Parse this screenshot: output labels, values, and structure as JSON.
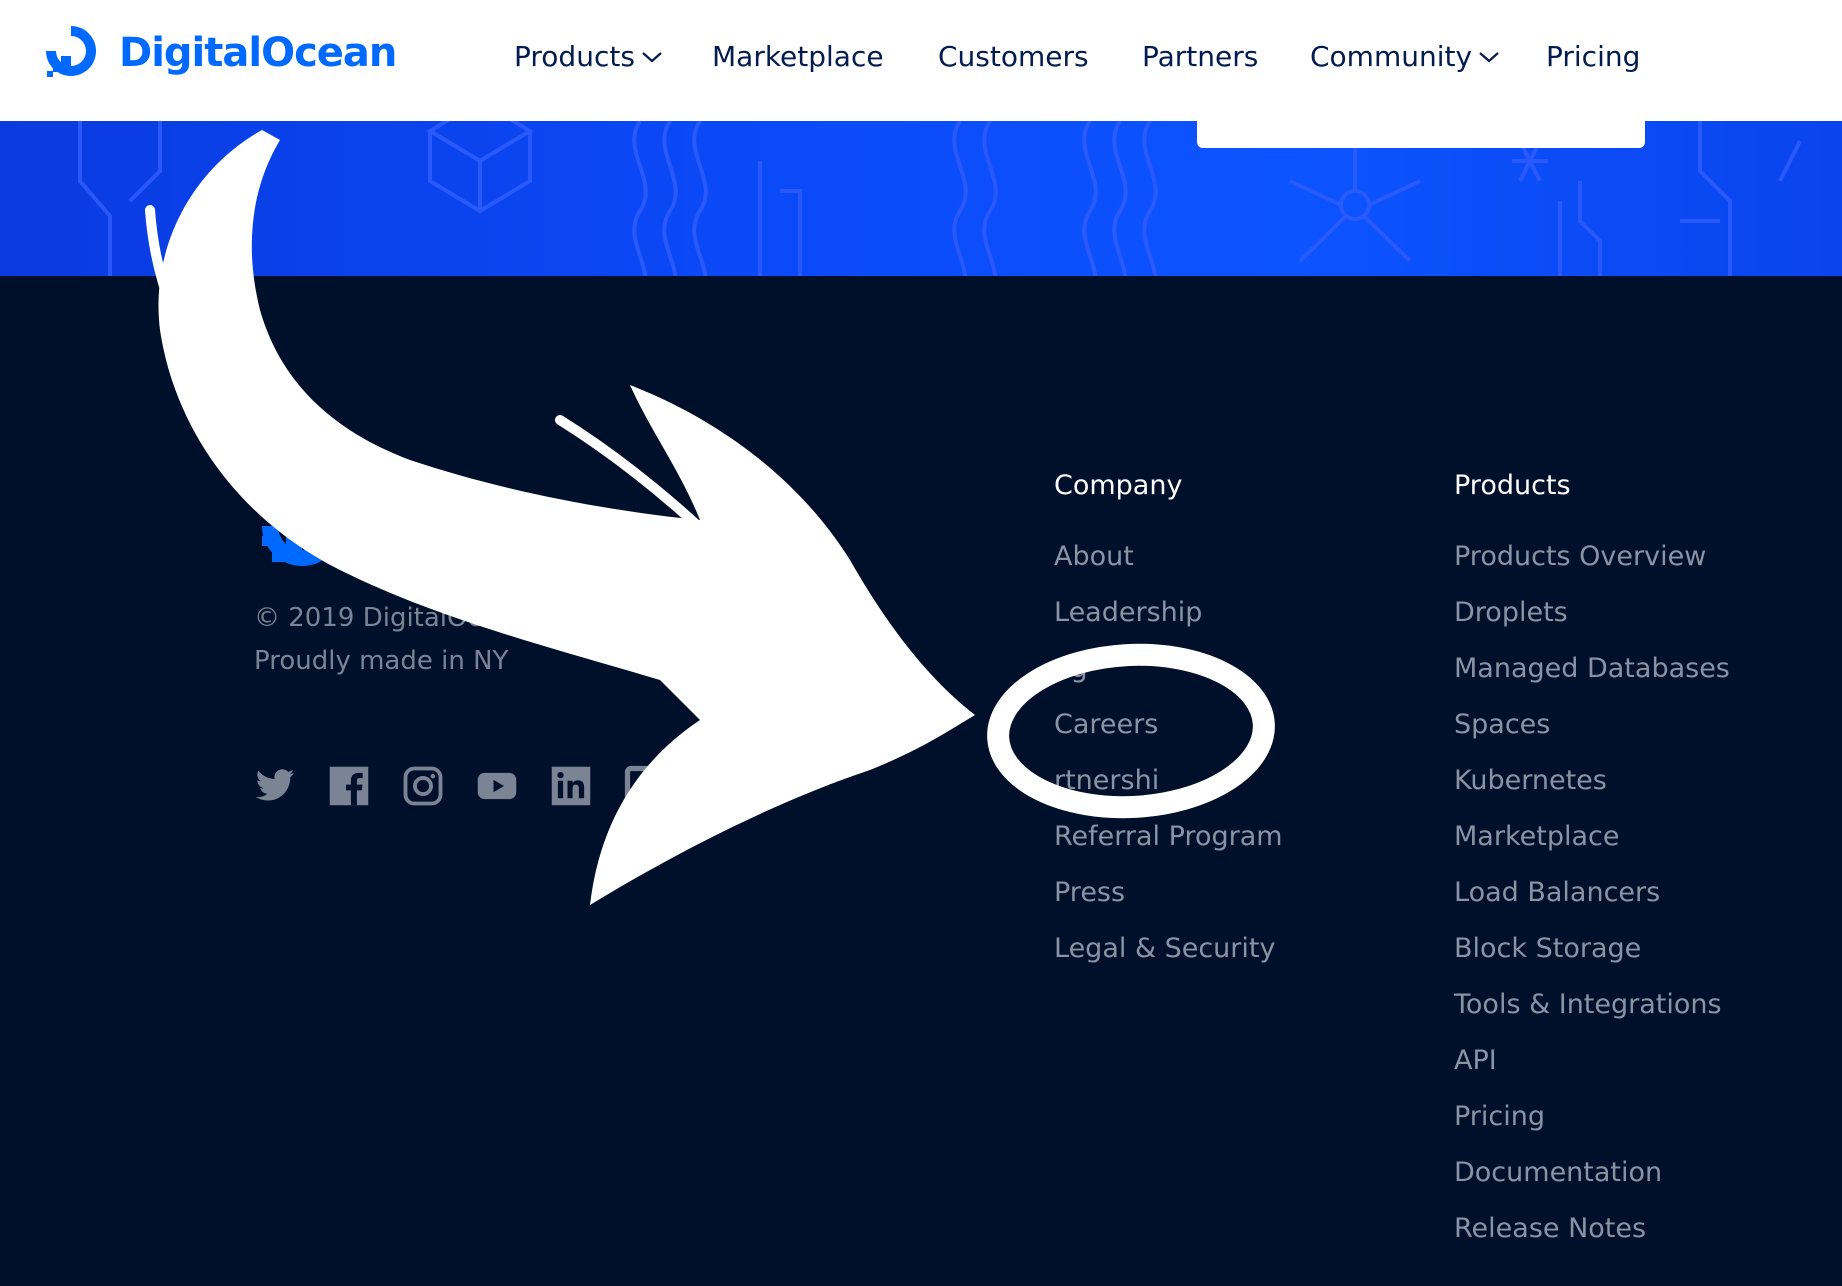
{
  "brand": {
    "name": "DigitalOcean",
    "color": "#0069ff",
    "logo_icon": "digitalocean-logo-icon"
  },
  "nav": {
    "items": [
      {
        "label": "Products",
        "has_dropdown": true
      },
      {
        "label": "Marketplace",
        "has_dropdown": false
      },
      {
        "label": "Customers",
        "has_dropdown": false
      },
      {
        "label": "Partners",
        "has_dropdown": false
      },
      {
        "label": "Community",
        "has_dropdown": true
      },
      {
        "label": "Pricing",
        "has_dropdown": false
      }
    ]
  },
  "footer": {
    "copyright": "© 2019 DigitalOc",
    "tagline": "Proudly made in NY",
    "social_icons": [
      "twitter-icon",
      "facebook-icon",
      "instagram-icon",
      "youtube-icon",
      "linkedin-icon",
      "partial-icon"
    ],
    "company": {
      "heading": "Company",
      "links": [
        "About",
        "Leadership",
        "og",
        "Careers",
        "rtnershi",
        "Referral Program",
        "Press",
        "Legal & Security"
      ]
    },
    "products": {
      "heading": "Products",
      "links": [
        "Products Overview",
        "Droplets",
        "Managed Databases",
        "Spaces",
        "Kubernetes",
        "Marketplace",
        "Load Balancers",
        "Block Storage",
        "Tools & Integrations",
        "API",
        "Pricing",
        "Documentation",
        "Release Notes"
      ]
    }
  },
  "colors": {
    "nav_text": "#031b4e",
    "footer_bg": "#000f2a",
    "band_blue": "#0b49f7",
    "footer_link": "#8a93a3",
    "annotation": "#ffffff"
  },
  "annotation": {
    "type": "hand-drawn white arrow and circle",
    "target": "Careers"
  }
}
